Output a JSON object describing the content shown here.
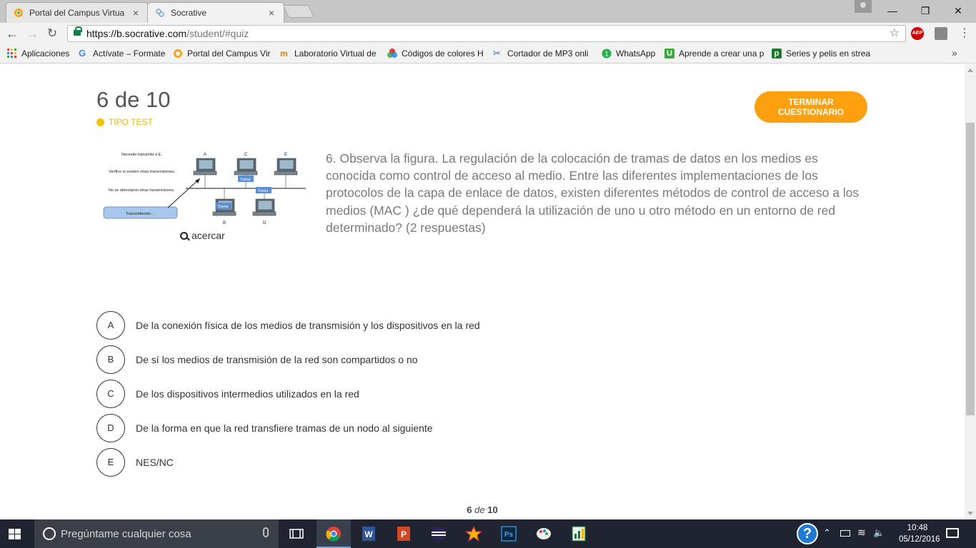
{
  "browser": {
    "tabs": [
      {
        "title": "Portal del Campus Virtua",
        "close": "×",
        "active": false
      },
      {
        "title": "Socrative",
        "close": "×",
        "active": true
      }
    ],
    "url_host": "https://b.socrative.com",
    "url_path": "/student/#quiz",
    "bookmarks": [
      {
        "label": "Aplicaciones",
        "icon": "apps-grid-icon",
        "color": "#3a6fd1"
      },
      {
        "label": "Actívate – Formate",
        "icon": "google-g-icon",
        "color": "#4285f4"
      },
      {
        "label": "Portal del Campus Vir",
        "icon": "campus-icon",
        "color": "#f4a61d"
      },
      {
        "label": "Laboratorio Virtual de",
        "icon": "lab-icon",
        "color": "#e07b00"
      },
      {
        "label": "Códigos de colores H",
        "icon": "colors-icon",
        "color": "#c2185b"
      },
      {
        "label": "Cortador de MP3 onli",
        "icon": "scissors-icon",
        "color": "#3060c0"
      },
      {
        "label": "WhatsApp",
        "icon": "whatsapp-icon",
        "color": "#25b14c"
      },
      {
        "label": "Aprende a crear una p",
        "icon": "u-icon",
        "color": "#3aa83a"
      },
      {
        "label": "Series y pelis en strea",
        "icon": "p-icon",
        "color": "#1b7a2b"
      }
    ],
    "bookmarks_more": "»"
  },
  "quiz": {
    "progress": "6 de 10",
    "type_label": "TIPO TEST",
    "finish_button": "TERMINAR CUESTIONARIO",
    "zoom_label": "acercar",
    "question": "6. Observa la figura. La regulación de la colocación de tramas de datos en los medios es conocida como control de acceso al medio. Entre las diferentes implementaciones de los protocolos de la capa de enlace de datos, existen diferentes métodos de control de acceso a los medios (MAC ) ¿de qué dependerá la utilización de uno u otro método en un entorno de red determinado? (2 respuestas)",
    "figure": {
      "labels": [
        "Necesito transmitir a E.",
        "Verifico si existen otras transmisiones.",
        "No se detectaron otras transmisiones.",
        "Transmitiendo..."
      ],
      "nodes": [
        "A",
        "C",
        "E",
        "B",
        "D"
      ],
      "frame_label": "Trama"
    },
    "answers": [
      {
        "letter": "A",
        "text": "De la conexión física de los medios de transmisión y los dispositivos en la red"
      },
      {
        "letter": "B",
        "text": "De sí los medios de transmisión de la red son compartidos o no"
      },
      {
        "letter": "C",
        "text": "De los dispositivos intermedios utilizados en la red"
      },
      {
        "letter": "D",
        "text": "De la forma en que la red transfiere tramas de un nodo al siguiente"
      },
      {
        "letter": "E",
        "text": "NES/NC"
      }
    ],
    "footer": {
      "current": "6",
      "sep": "de",
      "total": "10"
    }
  },
  "taskbar": {
    "search_placeholder": "Pregúntame cualquier cosa",
    "time": "10:48",
    "date": "05/12/2016",
    "apps": [
      "task-view-icon",
      "chrome-icon",
      "word-icon",
      "powerpoint-icon",
      "eclipse-icon",
      "star-app-icon",
      "photoshop-icon",
      "paint-icon",
      "excel-file-icon"
    ]
  },
  "colors": {
    "accent_orange": "#fca010",
    "type_yellow": "#f1c30a",
    "question_gray": "#7a7a7a"
  }
}
